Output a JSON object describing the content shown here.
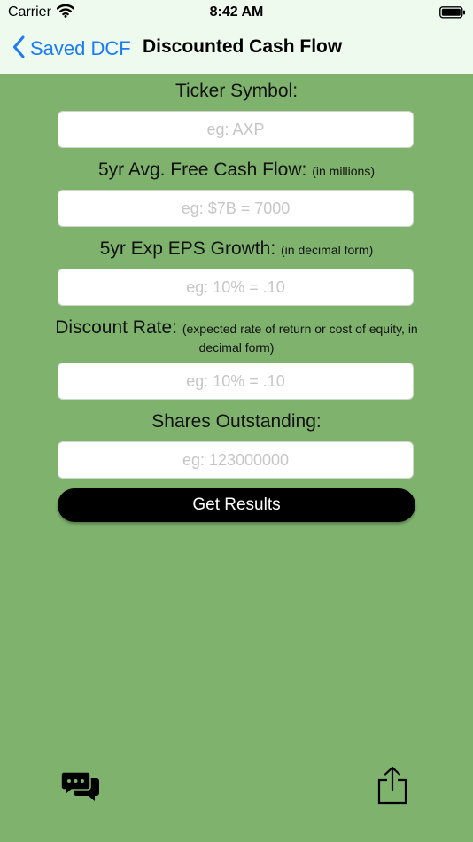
{
  "status_bar": {
    "carrier": "Carrier",
    "time": "8:42 AM",
    "icons": [
      "wifi-icon",
      "battery-icon"
    ]
  },
  "nav": {
    "back_label": "Saved DCF",
    "title": "Discounted Cash Flow",
    "accent_color": "#1a7cf5"
  },
  "form": {
    "background_color": "#7fb36d",
    "fields": [
      {
        "label": "Ticker Symbol:",
        "note": "",
        "placeholder": "eg: AXP",
        "value": ""
      },
      {
        "label": "5yr Avg. Free Cash Flow:",
        "note": "(in millions)",
        "placeholder": "eg: $7B = 7000",
        "value": ""
      },
      {
        "label": "5yr Exp EPS Growth:",
        "note": "(in decimal form)",
        "placeholder": "eg: 10% = .10",
        "value": ""
      },
      {
        "label": "Discount Rate:",
        "note": "(expected rate of return or cost of equity, in decimal form)",
        "placeholder": "eg: 10% = .10",
        "value": ""
      },
      {
        "label": "Shares Outstanding:",
        "note": "",
        "placeholder": "eg: 123000000",
        "value": ""
      }
    ],
    "submit_label": "Get Results"
  },
  "toolbar": {
    "icons": [
      "chat-bubbles-icon",
      "share-icon"
    ]
  }
}
